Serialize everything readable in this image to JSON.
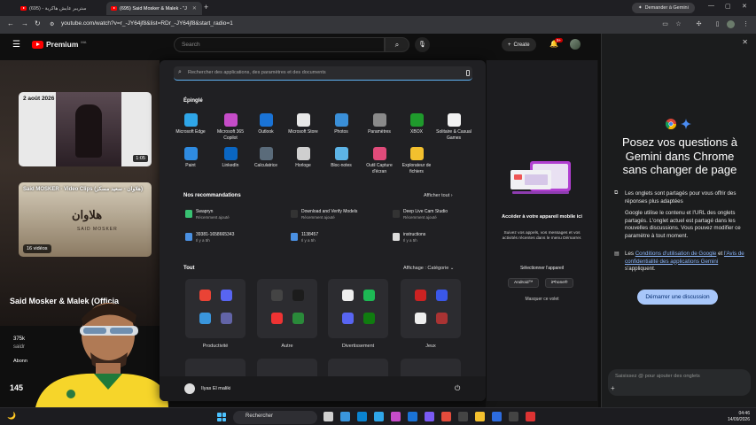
{
  "browser": {
    "tabs": [
      {
        "title": "ستريبر عايش هاكرية - (695)"
      },
      {
        "title": "(695) Said Mosker & Malek - \"J"
      }
    ],
    "gemini_button": "Demander à Gemini",
    "url": "youtube.com/watch?v=r_-JY64jf8&list=RDr_-JY64jf8&start_radio=1"
  },
  "youtube": {
    "logo": "Premium",
    "logo_sup": "MA",
    "search_placeholder": "Search",
    "create_label": "Create",
    "notif_count": "9+",
    "card1": {
      "date": "2 août 2026",
      "duration": "1:05"
    },
    "card2": {
      "title": "Said MOSKER - Video Clips (هلاوان - سعيد مسكر)",
      "art": "هلاوان",
      "art_sub": "SAID MOSKER",
      "count": "16 vidéos"
    },
    "channel": "Said Mosker & Malek (Officia",
    "views": "375k",
    "sub": "saidr",
    "subscribe": "Abonn",
    "count2": "145"
  },
  "start_menu": {
    "search_placeholder": "Rechercher des applications, des paramètres et des documents",
    "pinned_heading": "Épinglé",
    "pinned": [
      {
        "label": "Microsoft Edge",
        "color": "#2fa6e8"
      },
      {
        "label": "Microsoft 365 Copilot",
        "color": "#c54cc8"
      },
      {
        "label": "Outlook",
        "color": "#1a73d6"
      },
      {
        "label": "Microsoft Store",
        "color": "#e8e8e8"
      },
      {
        "label": "Photos",
        "color": "#3a8fd8"
      },
      {
        "label": "Paramètres",
        "color": "#8a8a8a"
      },
      {
        "label": "XBOX",
        "color": "#1f9a2c"
      },
      {
        "label": "Solitaire & Casual Games",
        "color": "#f2f2f2"
      },
      {
        "label": "Paint",
        "color": "#2f8be0"
      },
      {
        "label": "LinkedIn",
        "color": "#0a66c2"
      },
      {
        "label": "Calculatrice",
        "color": "#5a6b7a"
      },
      {
        "label": "Horloge",
        "color": "#cfcfcf"
      },
      {
        "label": "Bloc-notes",
        "color": "#5db4e6"
      },
      {
        "label": "Outil Capture d'écran",
        "color": "#e04b7a"
      },
      {
        "label": "Explorateur de fichiers",
        "color": "#f3c02e"
      }
    ],
    "rec_heading": "Nos recommandations",
    "all_button": "Afficher tout",
    "recommendations": [
      {
        "title": "Swapryn",
        "sub": "Récemment ajouté",
        "color": "#38c172"
      },
      {
        "title": "Download and Verify Models",
        "sub": "Récemment ajouté",
        "color": "#333"
      },
      {
        "title": "Deep Live Cam Studio",
        "sub": "Récemment ajouté",
        "color": "#333"
      },
      {
        "title": "39381-1658665343",
        "sub": "Il y a 5h",
        "color": "#4a90e2"
      },
      {
        "title": "1138457",
        "sub": "Il y a 5h",
        "color": "#4a90e2"
      },
      {
        "title": "instructions",
        "sub": "Il y a 5h",
        "color": "#ddd"
      }
    ],
    "all_heading": "Tout",
    "display_label": "Affichage : Catégorie",
    "folders": [
      {
        "label": "Productivité"
      },
      {
        "label": "Autre"
      },
      {
        "label": "Divertissement"
      },
      {
        "label": "Jeux"
      }
    ],
    "user": "Ilyas El maliki"
  },
  "phone_panel": {
    "title": "Accéder à votre appareil mobile ici",
    "body": "Suivez vos appels, vos messages et vos activités récentes dans le menu Démarrer.",
    "select": "Sélectionner l'appareil",
    "android": "Android™",
    "iphone": "iPhone®",
    "hide": "Masquer ce volet"
  },
  "gemini": {
    "heading": "Posez vos questions à Gemini dans Chrome sans changer de page",
    "para1": "Les onglets sont partagés pour vous offrir des réponses plus adaptées",
    "para2": "Google utilise le contenu et l'URL des onglets partagés. L'onglet actuel est partagé dans les nouvelles discussions. Vous pouvez modifier ce paramètre à tout moment.",
    "para3_prefix": "Les ",
    "para3_link1": "Conditions d'utilisation de Google",
    "para3_mid": " et ",
    "para3_link2": "l'Avis de confidentialité des applications Gemini",
    "para3_suffix": " s'appliquent.",
    "start_button": "Démarrer une discussion",
    "input_placeholder": "Saisissez @ pour ajouter des onglets"
  },
  "taskbar": {
    "search_placeholder": "Rechercher",
    "time": "04:46",
    "date": "14/09/2026"
  }
}
